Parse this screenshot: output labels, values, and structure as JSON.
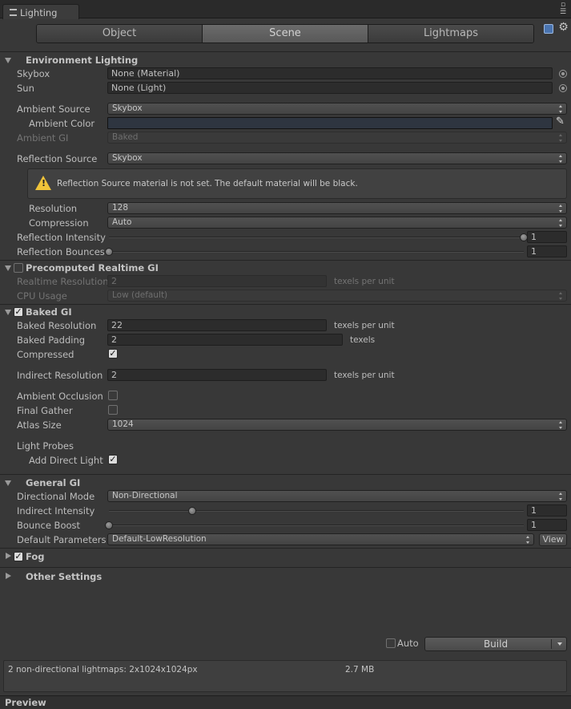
{
  "window": {
    "tab_title": "Lighting"
  },
  "modes": [
    "Object",
    "Scene",
    "Lightmaps"
  ],
  "selected_mode": "Scene",
  "environment": {
    "header": "Environment Lighting",
    "skybox_label": "Skybox",
    "skybox_value": "None (Material)",
    "sun_label": "Sun",
    "sun_value": "None (Light)",
    "ambient_source_label": "Ambient Source",
    "ambient_source_value": "Skybox",
    "ambient_color_label": "Ambient Color",
    "ambient_gi_label": "Ambient GI",
    "ambient_gi_value": "Baked",
    "reflection_source_label": "Reflection Source",
    "reflection_source_value": "Skybox",
    "warning_text": "Reflection Source material is not set. The default material will be black.",
    "resolution_label": "Resolution",
    "resolution_value": "128",
    "compression_label": "Compression",
    "compression_value": "Auto",
    "reflection_intensity_label": "Reflection Intensity",
    "reflection_intensity_value": "1",
    "reflection_bounces_label": "Reflection Bounces",
    "reflection_bounces_value": "1"
  },
  "precomputed": {
    "header": "Precomputed Realtime GI",
    "realtime_resolution_label": "Realtime Resolution",
    "realtime_resolution_value": "2",
    "texels_per_unit": "texels per unit",
    "cpu_usage_label": "CPU Usage",
    "cpu_usage_value": "Low (default)"
  },
  "baked": {
    "header": "Baked GI",
    "baked_resolution_label": "Baked Resolution",
    "baked_resolution_value": "22",
    "texels_per_unit": "texels per unit",
    "baked_padding_label": "Baked Padding",
    "baked_padding_value": "2",
    "texels": "texels",
    "compressed_label": "Compressed",
    "indirect_resolution_label": "Indirect Resolution",
    "indirect_resolution_value": "2",
    "ambient_occlusion_label": "Ambient Occlusion",
    "final_gather_label": "Final Gather",
    "atlas_size_label": "Atlas Size",
    "atlas_size_value": "1024",
    "light_probes_label": "Light Probes",
    "add_direct_light_label": "Add Direct Light"
  },
  "general": {
    "header": "General GI",
    "directional_mode_label": "Directional Mode",
    "directional_mode_value": "Non-Directional",
    "indirect_intensity_label": "Indirect Intensity",
    "indirect_intensity_value": "1",
    "bounce_boost_label": "Bounce Boost",
    "bounce_boost_value": "1",
    "default_parameters_label": "Default Parameters",
    "default_parameters_value": "Default-LowResolution",
    "view_button": "View"
  },
  "fog": {
    "header": "Fog"
  },
  "other": {
    "header": "Other Settings"
  },
  "build": {
    "auto_label": "Auto",
    "build_button": "Build"
  },
  "info": {
    "lightmaps_text": "2 non-directional lightmaps: 2x1024x1024px",
    "size_text": "2.7 MB"
  },
  "preview": {
    "label": "Preview"
  },
  "states": {
    "precomputed_enabled": false,
    "baked_enabled": true,
    "compressed": true,
    "ambient_occlusion": false,
    "final_gather": false,
    "add_direct_light": true,
    "fog_enabled": true,
    "auto": false,
    "reflection_intensity_level": 1.0,
    "reflection_bounces_level": 0.0,
    "indirect_intensity_level": 0.2,
    "bounce_boost_level": 0.0
  },
  "colors": {
    "ambient_color": "#2e3540",
    "warning": "#f0c43a",
    "selected_tab": "#5e5e5e"
  }
}
